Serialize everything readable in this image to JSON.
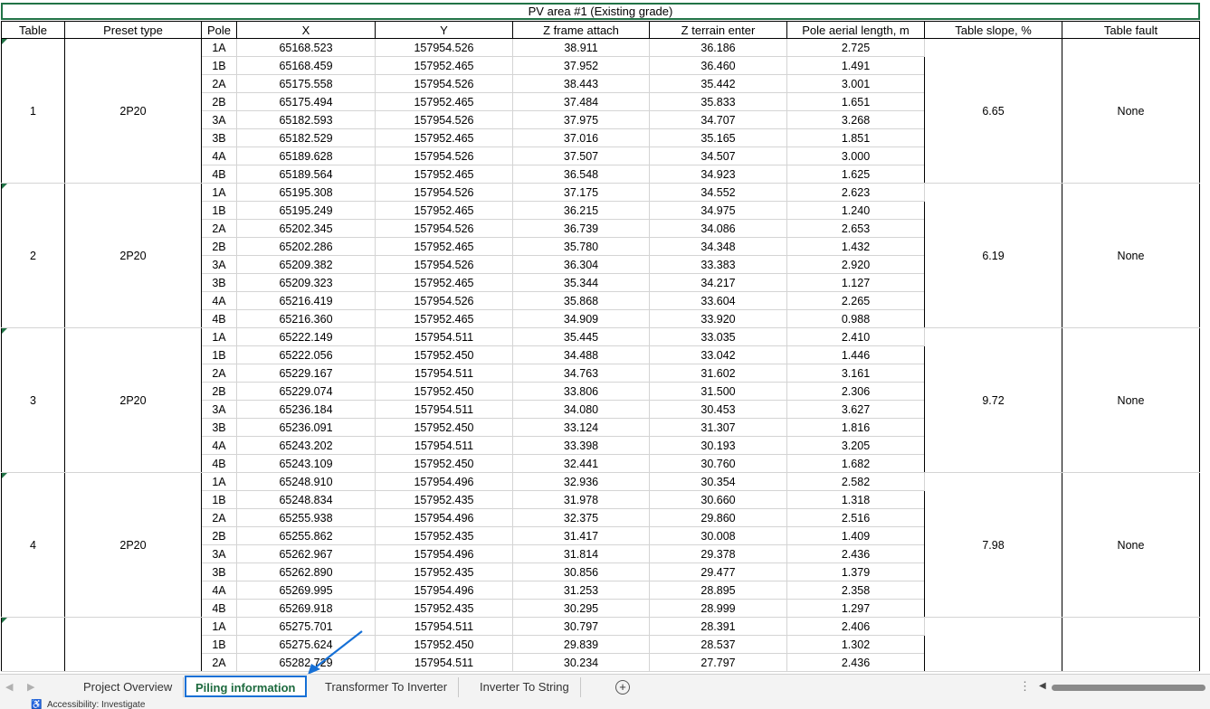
{
  "sheet": {
    "title": "PV area #1 (Existing grade)",
    "headers": [
      "Table",
      "Preset type",
      "Pole",
      "X",
      "Y",
      "Z frame attach",
      "Z terrain enter",
      "Pole aerial length, m",
      "Table slope, %",
      "Table fault"
    ],
    "groups": [
      {
        "table": "1",
        "preset": "2P20",
        "slope": "6.65",
        "fault": "None",
        "rows": [
          [
            "1A",
            "65168.523",
            "157954.526",
            "38.911",
            "36.186",
            "2.725"
          ],
          [
            "1B",
            "65168.459",
            "157952.465",
            "37.952",
            "36.460",
            "1.491"
          ],
          [
            "2A",
            "65175.558",
            "157954.526",
            "38.443",
            "35.442",
            "3.001"
          ],
          [
            "2B",
            "65175.494",
            "157952.465",
            "37.484",
            "35.833",
            "1.651"
          ],
          [
            "3A",
            "65182.593",
            "157954.526",
            "37.975",
            "34.707",
            "3.268"
          ],
          [
            "3B",
            "65182.529",
            "157952.465",
            "37.016",
            "35.165",
            "1.851"
          ],
          [
            "4A",
            "65189.628",
            "157954.526",
            "37.507",
            "34.507",
            "3.000"
          ],
          [
            "4B",
            "65189.564",
            "157952.465",
            "36.548",
            "34.923",
            "1.625"
          ]
        ]
      },
      {
        "table": "2",
        "preset": "2P20",
        "slope": "6.19",
        "fault": "None",
        "rows": [
          [
            "1A",
            "65195.308",
            "157954.526",
            "37.175",
            "34.552",
            "2.623"
          ],
          [
            "1B",
            "65195.249",
            "157952.465",
            "36.215",
            "34.975",
            "1.240"
          ],
          [
            "2A",
            "65202.345",
            "157954.526",
            "36.739",
            "34.086",
            "2.653"
          ],
          [
            "2B",
            "65202.286",
            "157952.465",
            "35.780",
            "34.348",
            "1.432"
          ],
          [
            "3A",
            "65209.382",
            "157954.526",
            "36.304",
            "33.383",
            "2.920"
          ],
          [
            "3B",
            "65209.323",
            "157952.465",
            "35.344",
            "34.217",
            "1.127"
          ],
          [
            "4A",
            "65216.419",
            "157954.526",
            "35.868",
            "33.604",
            "2.265"
          ],
          [
            "4B",
            "65216.360",
            "157952.465",
            "34.909",
            "33.920",
            "0.988"
          ]
        ]
      },
      {
        "table": "3",
        "preset": "2P20",
        "slope": "9.72",
        "fault": "None",
        "rows": [
          [
            "1A",
            "65222.149",
            "157954.511",
            "35.445",
            "33.035",
            "2.410"
          ],
          [
            "1B",
            "65222.056",
            "157952.450",
            "34.488",
            "33.042",
            "1.446"
          ],
          [
            "2A",
            "65229.167",
            "157954.511",
            "34.763",
            "31.602",
            "3.161"
          ],
          [
            "2B",
            "65229.074",
            "157952.450",
            "33.806",
            "31.500",
            "2.306"
          ],
          [
            "3A",
            "65236.184",
            "157954.511",
            "34.080",
            "30.453",
            "3.627"
          ],
          [
            "3B",
            "65236.091",
            "157952.450",
            "33.124",
            "31.307",
            "1.816"
          ],
          [
            "4A",
            "65243.202",
            "157954.511",
            "33.398",
            "30.193",
            "3.205"
          ],
          [
            "4B",
            "65243.109",
            "157952.450",
            "32.441",
            "30.760",
            "1.682"
          ]
        ]
      },
      {
        "table": "4",
        "preset": "2P20",
        "slope": "7.98",
        "fault": "None",
        "rows": [
          [
            "1A",
            "65248.910",
            "157954.496",
            "32.936",
            "30.354",
            "2.582"
          ],
          [
            "1B",
            "65248.834",
            "157952.435",
            "31.978",
            "30.660",
            "1.318"
          ],
          [
            "2A",
            "65255.938",
            "157954.496",
            "32.375",
            "29.860",
            "2.516"
          ],
          [
            "2B",
            "65255.862",
            "157952.435",
            "31.417",
            "30.008",
            "1.409"
          ],
          [
            "3A",
            "65262.967",
            "157954.496",
            "31.814",
            "29.378",
            "2.436"
          ],
          [
            "3B",
            "65262.890",
            "157952.435",
            "30.856",
            "29.477",
            "1.379"
          ],
          [
            "4A",
            "65269.995",
            "157954.496",
            "31.253",
            "28.895",
            "2.358"
          ],
          [
            "4B",
            "65269.918",
            "157952.435",
            "30.295",
            "28.999",
            "1.297"
          ]
        ]
      },
      {
        "table": "",
        "preset": "",
        "slope": "",
        "fault": "",
        "rows": [
          [
            "1A",
            "65275.701",
            "157954.511",
            "30.797",
            "28.391",
            "2.406"
          ],
          [
            "1B",
            "65275.624",
            "157952.450",
            "29.839",
            "28.537",
            "1.302"
          ],
          [
            "2A",
            "65282.729",
            "157954.511",
            "30.234",
            "27.797",
            "2.436"
          ]
        ]
      }
    ]
  },
  "tabs": {
    "items": [
      "Project Overview",
      "Piling information",
      "Transformer To Inverter",
      "Inverter To String"
    ],
    "active": "Piling information",
    "add_icon": "plus-circle-icon"
  },
  "status": {
    "text": "Accessibility: Investigate"
  },
  "colors": {
    "excel_green": "#217346",
    "active_tab_border": "#1670d6",
    "annotation_arrow": "#1670d6"
  }
}
